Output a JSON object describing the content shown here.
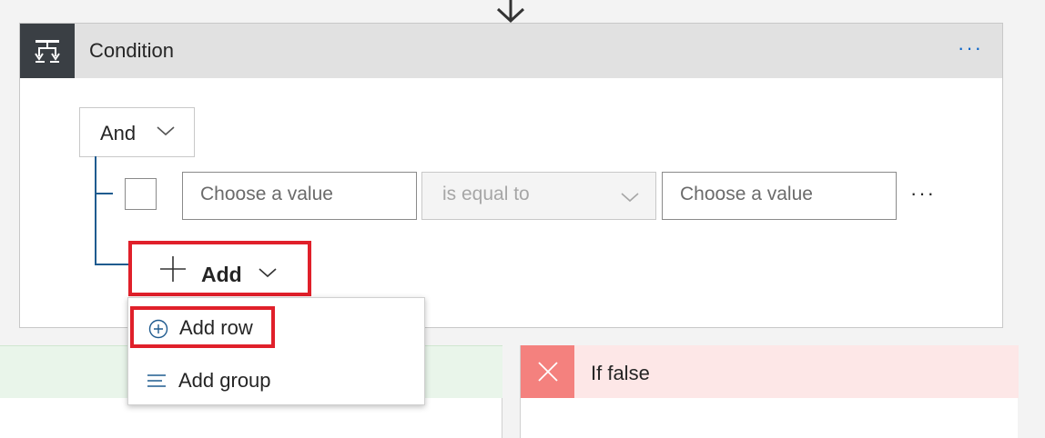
{
  "condition": {
    "icon": "condition-icon",
    "title": "Condition",
    "more": "···"
  },
  "group": {
    "operator": "And"
  },
  "row": {
    "left_placeholder": "Choose a value",
    "operator": "is equal to",
    "right_placeholder": "Choose a value",
    "more": "···"
  },
  "add_button": {
    "label": "Add"
  },
  "add_menu": {
    "items": [
      {
        "label": "Add row",
        "icon": "plus-circle-icon"
      },
      {
        "label": "Add group",
        "icon": "lines-icon"
      }
    ]
  },
  "branches": {
    "if_false": {
      "label": "If false",
      "icon": "close-icon"
    }
  },
  "colors": {
    "highlight": "#e0202a",
    "link": "#0a64c8",
    "tree": "#1f5b8f",
    "if_true_bg": "#e9f5ea",
    "if_false_bg": "#fde7e7",
    "if_false_icon_bg": "#f4817e"
  }
}
